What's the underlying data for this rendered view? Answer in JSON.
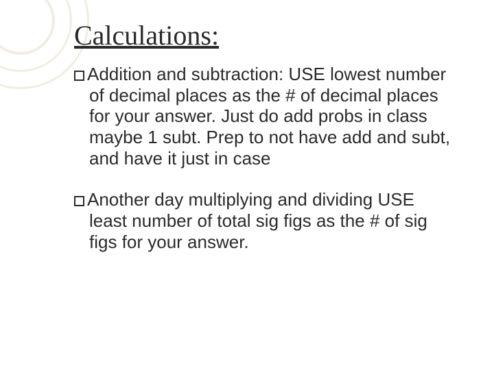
{
  "title": "Calculations:",
  "bullets": [
    {
      "lead": "Addition and subtraction: ",
      "rest": "USE lowest number of decimal places as the # of decimal places for your answer. Just do add probs in class maybe 1 subt. Prep to not have add and subt, and have it just in case"
    },
    {
      "lead": "Another day ",
      "rest": "multiplying and dividing USE least number of total sig figs as the # of sig figs for your answer."
    }
  ]
}
